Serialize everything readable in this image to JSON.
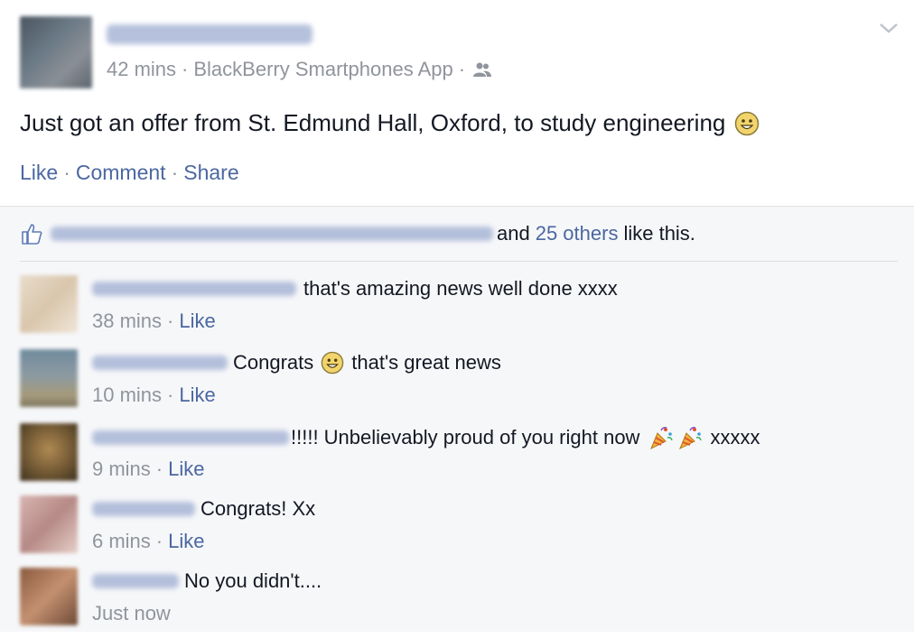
{
  "post": {
    "meta_time": "42 mins",
    "meta_app": "BlackBerry Smartphones App",
    "text": "Just got an offer from St. Edmund Hall, Oxford, to study engineering",
    "actions": {
      "like": "Like",
      "comment": "Comment",
      "share": "Share"
    }
  },
  "likes": {
    "and": "and",
    "others": "25 others",
    "suffix": "like this."
  },
  "comments": [
    {
      "text": "that's amazing news well done xxxx",
      "time": "38 mins",
      "like": "Like"
    },
    {
      "text_before": "Congrats",
      "text_after": "that's great news",
      "time": "10 mins",
      "like": "Like"
    },
    {
      "text": "!!!!! Unbelievably proud of you right now",
      "text_after": "xxxxx",
      "time": "9 mins",
      "like": "Like"
    },
    {
      "text": "Congrats! Xx",
      "time": "6 mins",
      "like": "Like"
    },
    {
      "text": "No you didn't....",
      "time": "Just now"
    }
  ],
  "colors": {
    "link": "#4b67a1",
    "meta": "#90949c",
    "feedback_bg": "#f6f7f9",
    "text": "#141823"
  },
  "icons": [
    "friends-icon",
    "chevron-down-icon",
    "smiley-emoji-icon",
    "like-thumb-icon",
    "party-popper-icon"
  ]
}
